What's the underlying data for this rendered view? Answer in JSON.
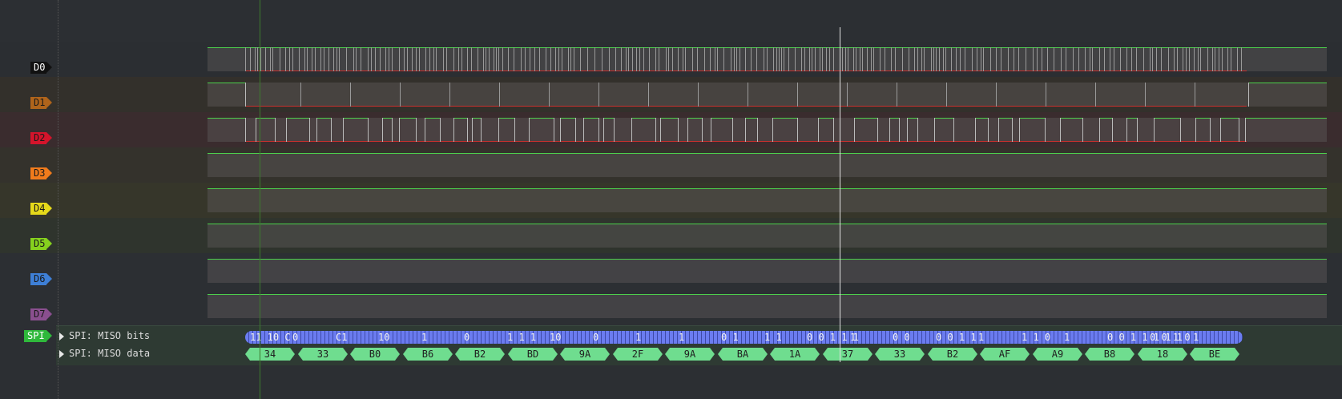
{
  "channels": [
    {
      "id": "D0",
      "label": "D0",
      "color": "#111111",
      "text": "#ffffff",
      "lane": "#2b2e32",
      "signal": "dense"
    },
    {
      "id": "D1",
      "label": "D1",
      "color": "#b0641b",
      "text": "#1a1a1a",
      "lane": "#33302b",
      "signal": "sparse"
    },
    {
      "id": "D2",
      "label": "D2",
      "color": "#d4142b",
      "text": "#1a1a1a",
      "lane": "#3a2c2e",
      "signal": "pulses"
    },
    {
      "id": "D3",
      "label": "D3",
      "color": "#f07b1c",
      "text": "#1a1a1a",
      "lane": "#34322c",
      "signal": "flat"
    },
    {
      "id": "D4",
      "label": "D4",
      "color": "#e6d91a",
      "text": "#1a1a1a",
      "lane": "#36362a",
      "signal": "flat"
    },
    {
      "id": "D5",
      "label": "D5",
      "color": "#86d11e",
      "text": "#1a1a1a",
      "lane": "#2f342d",
      "signal": "flat"
    },
    {
      "id": "D6",
      "label": "D6",
      "color": "#3e7fd6",
      "text": "#1a1a1a",
      "lane": "#2c2f33",
      "signal": "flat"
    },
    {
      "id": "D7",
      "label": "D7",
      "color": "#8a4f8f",
      "text": "#1a1a1a",
      "lane": "#2c2f33",
      "signal": "flat"
    }
  ],
  "decoder": {
    "badge": "SPI",
    "badge_color": "#2fb83b",
    "rows": [
      {
        "label": "SPI: MISO bits"
      },
      {
        "label": "SPI: MISO data"
      }
    ],
    "bits_fragments": [
      "11 10 C",
      "0",
      "C1",
      "10",
      "1",
      "0",
      "1 1 1",
      "10",
      "0",
      "1",
      "1",
      "0 1",
      "1 1",
      "0 0 1 1 1",
      "1",
      "0 0",
      "0 0 1 1",
      "1",
      "1 1 0",
      "1",
      "0 0 1 1 1 1 1",
      "0 0 1 0",
      "1"
    ],
    "bytes": [
      "34",
      "33",
      "B0",
      "B6",
      "B2",
      "BD",
      "9A",
      "2F",
      "9A",
      "BA",
      "1A",
      "37",
      "33",
      "B2",
      "AF",
      "A9",
      "B8",
      "18",
      "BE"
    ]
  },
  "colors": {
    "background": "#2c2f33",
    "signal_high": "#4ccf4c",
    "signal_low": "#c7302e",
    "cursor": "#e0e0e0",
    "marker": "#3d7a2e",
    "bits_fill": "#6b7cf0",
    "data_fill": "#6fdd8f"
  }
}
